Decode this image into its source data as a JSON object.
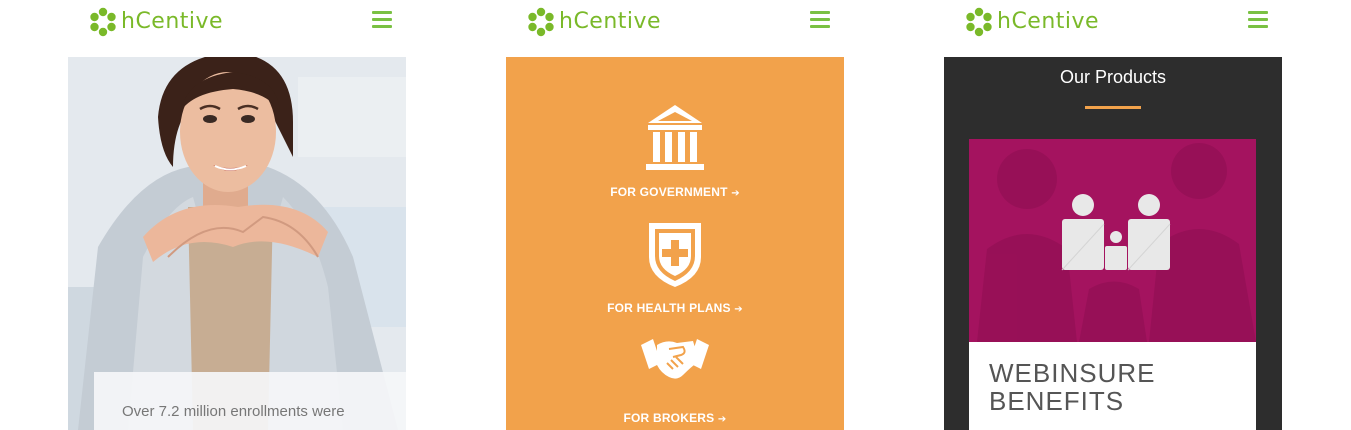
{
  "brand": {
    "name": "hCentive",
    "color": "#7ab929"
  },
  "menu_icon": "hamburger-icon",
  "screens": [
    {
      "hero_caption": "Over 7.2 million enrollments were"
    },
    {
      "background": "#f2a24b",
      "segments": [
        {
          "label": "FOR GOVERNMENT",
          "icon": "government-building-icon"
        },
        {
          "label": "FOR HEALTH PLANS",
          "icon": "health-shield-icon"
        },
        {
          "label": "FOR BROKERS",
          "icon": "handshake-icon"
        }
      ],
      "arrow": "➔"
    },
    {
      "section_title": "Our Products",
      "accent": "#f2a24b",
      "product": {
        "title": "WEBINSURE BENEFITS",
        "icon": "family-icon",
        "color": "#a4135f"
      }
    }
  ]
}
